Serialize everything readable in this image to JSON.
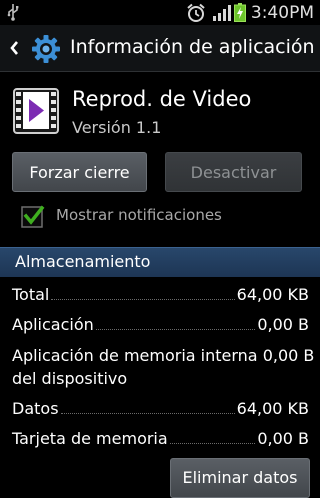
{
  "status_bar": {
    "time": "3:40PM",
    "icons": [
      "usb-icon",
      "alarm-icon",
      "signal-icon",
      "battery-charging-icon"
    ]
  },
  "header": {
    "title": "Información de aplicación",
    "icons": [
      "back-arrow-icon",
      "gear-icon"
    ]
  },
  "app": {
    "name": "Reprod. de Video",
    "version": "Versión 1.1",
    "icon": "video-player-icon"
  },
  "actions": {
    "force_stop": "Forzar cierre",
    "disable": "Desactivar"
  },
  "notifications": {
    "label": "Mostrar notificaciones",
    "checked": true
  },
  "storage": {
    "title": "Almacenamiento",
    "rows": [
      {
        "label": "Total",
        "value": "64,00 KB"
      },
      {
        "label": "Aplicación",
        "value": "0,00 B"
      },
      {
        "label_line1": "Aplicación de memoria interna",
        "label_line2": "del dispositivo",
        "value": "0,00 B"
      },
      {
        "label": "Datos",
        "value": "64,00 KB"
      },
      {
        "label": "Tarjeta de memoria",
        "value": "0,00 B"
      }
    ],
    "clear_data": "Eliminar datos"
  },
  "colors": {
    "background": "#000000",
    "section_header": "#23405f",
    "checkbox_check": "#3fae1f"
  }
}
